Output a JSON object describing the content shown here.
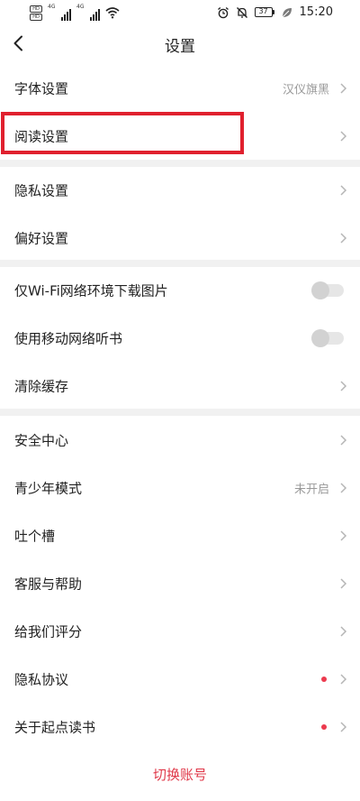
{
  "status_bar": {
    "sim1_tag": "HD",
    "sim2_tag": "HD",
    "network1": "4G",
    "network2": "4G",
    "battery_level": "37",
    "time": "15:20",
    "icons": [
      "alarm-icon",
      "mute-bell-icon",
      "battery-icon",
      "leaf-icon",
      "wifi-icon",
      "signal-icon"
    ]
  },
  "nav": {
    "title": "设置",
    "back_icon": "chevron-left-icon"
  },
  "section1": {
    "items": [
      {
        "label": "字体设置",
        "value": "汉仪旗黑"
      },
      {
        "label": "阅读设置",
        "value": ""
      }
    ]
  },
  "section2": {
    "items": [
      {
        "label": "隐私设置"
      },
      {
        "label": "偏好设置"
      }
    ]
  },
  "section3": {
    "items": [
      {
        "label": "仅Wi-Fi网络环境下载图片",
        "toggle_on": false
      },
      {
        "label": "使用移动网络听书",
        "toggle_on": false
      },
      {
        "label": "清除缓存"
      }
    ]
  },
  "section4": {
    "items": [
      {
        "label": "安全中心",
        "value": ""
      },
      {
        "label": "青少年模式",
        "value": "未开启"
      },
      {
        "label": "吐个槽",
        "value": ""
      },
      {
        "label": "客服与帮助",
        "value": ""
      },
      {
        "label": "给我们评分",
        "value": ""
      },
      {
        "label": "隐私协议",
        "badge": true
      },
      {
        "label": "关于起点读书",
        "badge": true
      }
    ]
  },
  "footer": {
    "switch_account": "切换账号"
  },
  "colors": {
    "highlight": "#e0202e",
    "accent": "#e0394a",
    "badge": "#ec3a4e",
    "divider": "#f1f1f1"
  }
}
